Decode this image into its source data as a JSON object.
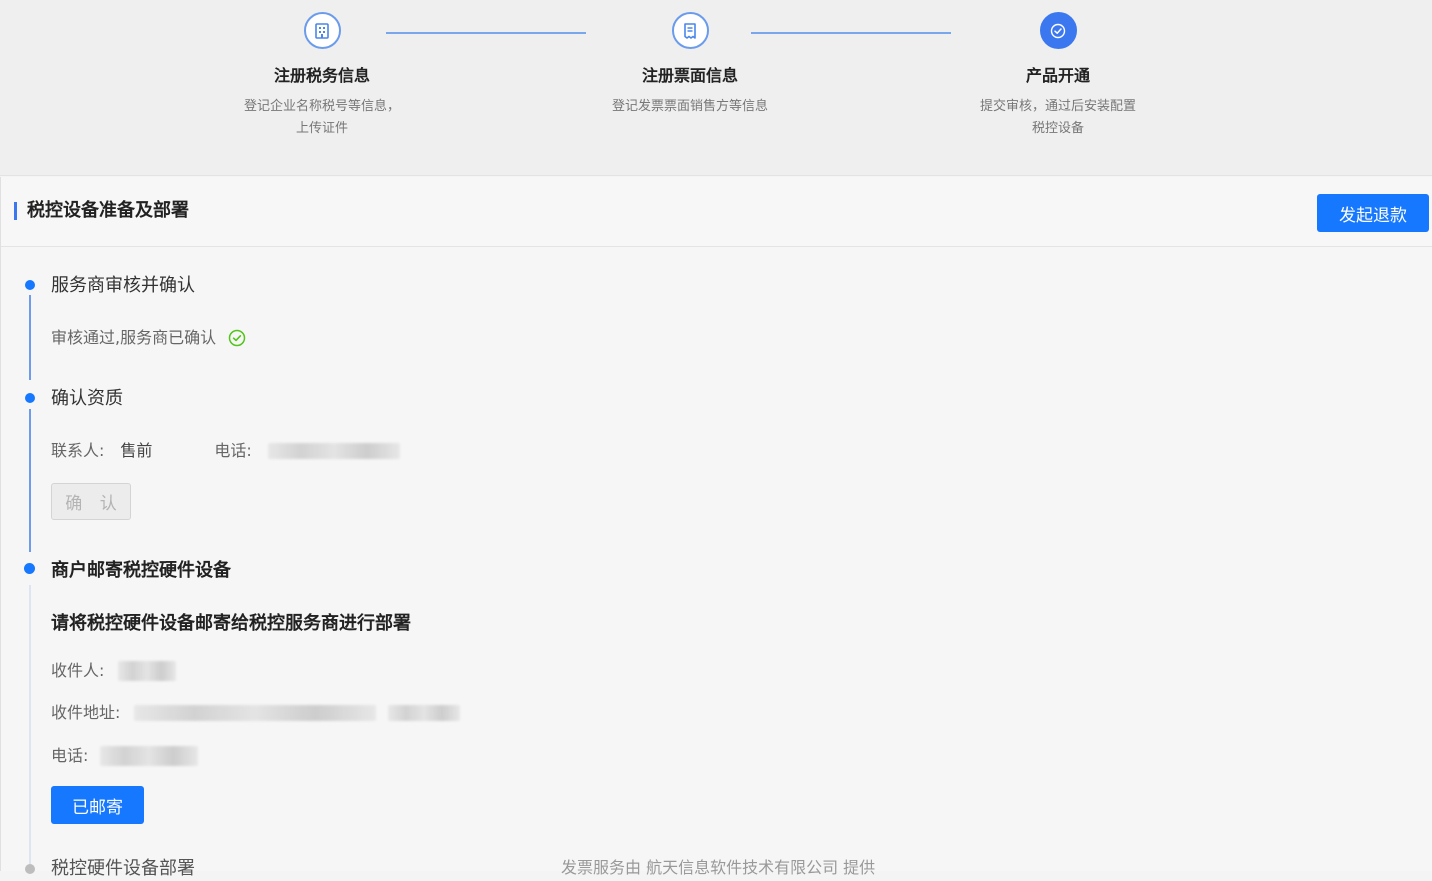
{
  "steps": [
    {
      "title": "注册税务信息",
      "desc": "登记企业名称税号等信息，上传证件",
      "icon": "building-doc-icon"
    },
    {
      "title": "注册票面信息",
      "desc": "登记发票票面销售方等信息",
      "icon": "invoice-icon"
    },
    {
      "title": "产品开通",
      "desc": "提交审核，通过后安装配置税控设备",
      "icon": "check-circle-icon"
    }
  ],
  "panel": {
    "title": "税控设备准备及部署",
    "refund_label": "发起退款"
  },
  "timeline": {
    "step1": {
      "title": "服务商审核并确认",
      "status": "审核通过,服务商已确认"
    },
    "step2": {
      "title": "确认资质",
      "contact_label": "联系人:",
      "contact_value": "售前",
      "phone_label": "电话:",
      "confirm_label": "确 认"
    },
    "step3": {
      "title": "商户邮寄税控硬件设备",
      "instruction": "请将税控硬件设备邮寄给税控服务商进行部署",
      "recipient_label": "收件人:",
      "address_label": "收件地址:",
      "phone_label": "电话:",
      "mailed_label": "已邮寄"
    },
    "step4": {
      "title": "税控硬件设备部署"
    }
  },
  "footer": {
    "note": "发票服务由 航天信息软件技术有限公司 提供"
  },
  "colors": {
    "primary": "#1677ff",
    "success": "#52c41a",
    "timeline": "#6f9cea"
  }
}
